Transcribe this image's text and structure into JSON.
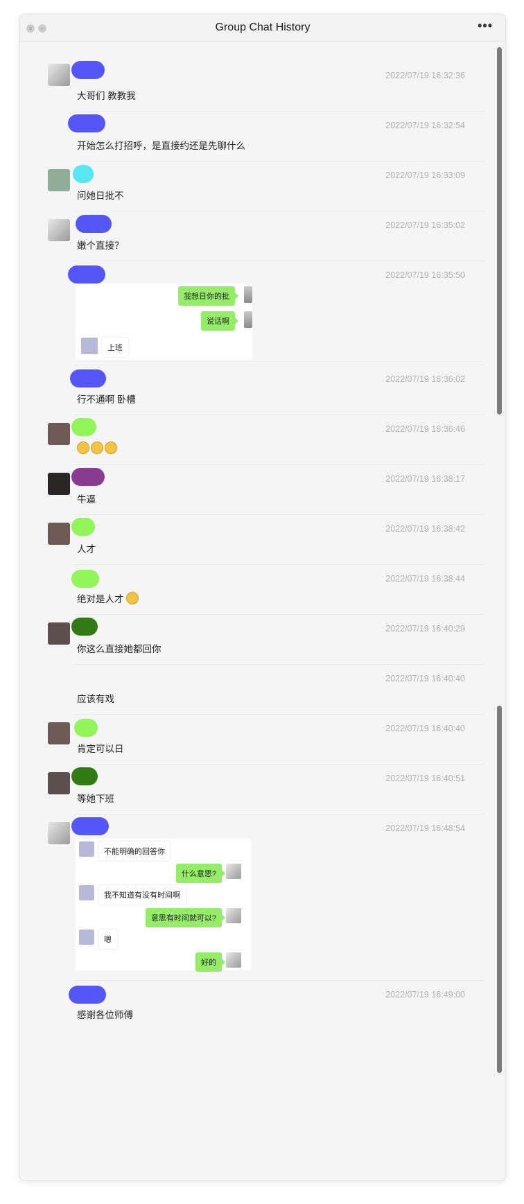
{
  "window": {
    "title": "Group Chat History",
    "more_label": "•••",
    "close_label": "×",
    "min_label": "–"
  },
  "colors": {
    "blue_blob": "#5556f6",
    "cyan_blob": "#58e6f2",
    "lime_blob": "#92f65a",
    "purple_blob": "#8a3d90",
    "dark_green_blob": "#327a14",
    "bubble_green": "#95ec69"
  },
  "messages": [
    {
      "time": "2022/07/19 16:32:36",
      "text": "大哥们 教教我"
    },
    {
      "time": "2022/07/19 16:32:54",
      "text": "开始怎么打招呼，是直接约还是先聊什么"
    },
    {
      "time": "2022/07/19 16:33:09",
      "text": "问她日批不"
    },
    {
      "time": "2022/07/19 16:35:02",
      "text": "嫩个直接？"
    },
    {
      "time": "2022/07/19 16:35:50",
      "text": ""
    },
    {
      "time": "2022/07/19 16:36:02",
      "text": "行不通啊 卧槽"
    },
    {
      "time": "2022/07/19 16:36:46",
      "text": ""
    },
    {
      "time": "2022/07/19 16:38:17",
      "text": "牛逼"
    },
    {
      "time": "2022/07/19 16:38:42",
      "text": "人才"
    },
    {
      "time": "2022/07/19 16:38:44",
      "text": "绝对是人才"
    },
    {
      "time": "2022/07/19 16:40:29",
      "text": "你这么直接她都回你"
    },
    {
      "time": "2022/07/19 16:40:40",
      "text": "应该有戏"
    },
    {
      "time": "2022/07/19 16:40:40",
      "text": "肯定可以日"
    },
    {
      "time": "2022/07/19 16:40:51",
      "text": "等她下班"
    },
    {
      "time": "2022/07/19 16:48:54",
      "text": ""
    },
    {
      "time": "2022/07/19 16:49:00",
      "text": "感谢各位师傅"
    }
  ],
  "screenshot1": {
    "b1": "我想日你的批",
    "b2": "说话啊",
    "b3": "上班"
  },
  "screenshot2": {
    "b1": "不能明确的回答你",
    "b2": "什么意思?",
    "b3": "我不知道有没有时间啊",
    "b4": "意思有时间就可以?",
    "b5": "嗯",
    "b6": "好的"
  }
}
